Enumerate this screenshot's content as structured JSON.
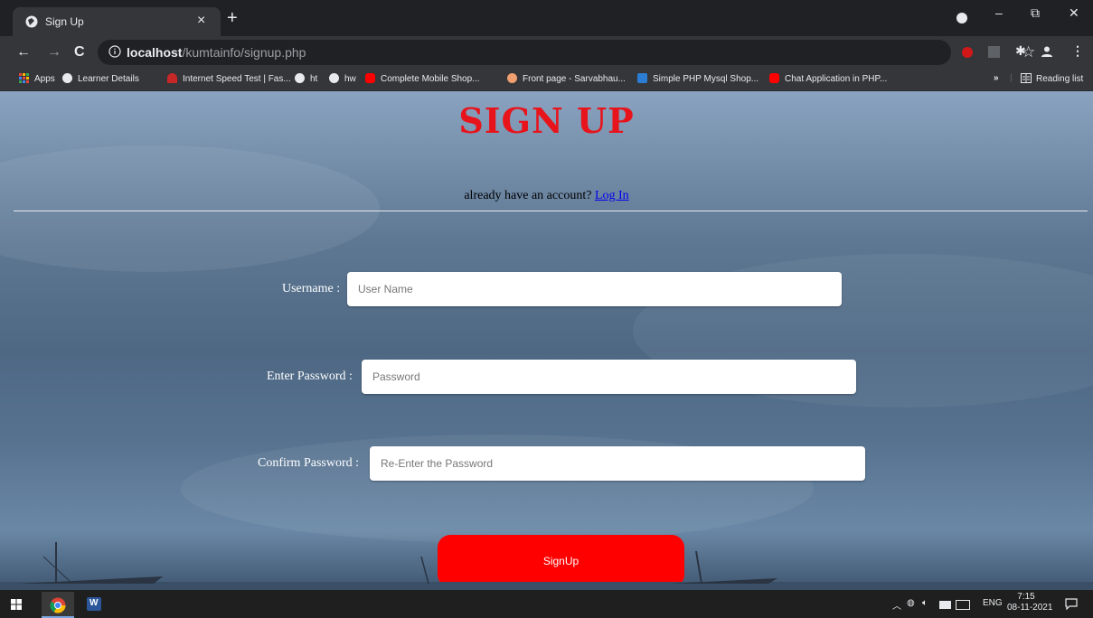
{
  "browser": {
    "tab_title": "Sign Up",
    "tab_close": "×",
    "new_tab": "+",
    "address_host": "localhost",
    "address_path": "/kumtainfo/signup.php",
    "window_controls": {
      "minimize": "–",
      "maximize": "⧉",
      "close": "✕"
    },
    "nav": {
      "back": "←",
      "forward": "→",
      "reload": "C"
    }
  },
  "bookmarks": {
    "items": [
      {
        "label": "Apps",
        "icon": "apps-grid-icon"
      },
      {
        "label": "Learner Details",
        "icon": "globe-icon"
      },
      {
        "label": "Internet Speed Test | Fas...",
        "icon": "speedtest-icon"
      },
      {
        "label": "ht",
        "icon": "globe-icon"
      },
      {
        "label": "hw",
        "icon": "globe-icon"
      },
      {
        "label": "Complete Mobile Shop...",
        "icon": "youtube-icon"
      },
      {
        "label": "Front page - Sarvabhau...",
        "icon": "site-icon"
      },
      {
        "label": "Simple PHP Mysql Shop...",
        "icon": "word-w-icon"
      },
      {
        "label": "Chat Application in PHP...",
        "icon": "youtube-icon"
      }
    ],
    "overflow": "»",
    "reading_list": "Reading list"
  },
  "page": {
    "heading": "SIGN UP",
    "already_text": "already have an account?",
    "login_link": "Log In",
    "fields": [
      {
        "label": "Username :",
        "placeholder": "User Name"
      },
      {
        "label": "Enter Password :",
        "placeholder": "Password"
      },
      {
        "label": "Confirm Password :",
        "placeholder": "Re-Enter the Password"
      }
    ],
    "submit_label": "SignUp"
  },
  "taskbar": {
    "language": "ENG",
    "time": "7:15",
    "date": "08-11-2021"
  },
  "colors": {
    "heading": "#e8141c",
    "button": "#ff0000",
    "link": "#0000ee"
  }
}
